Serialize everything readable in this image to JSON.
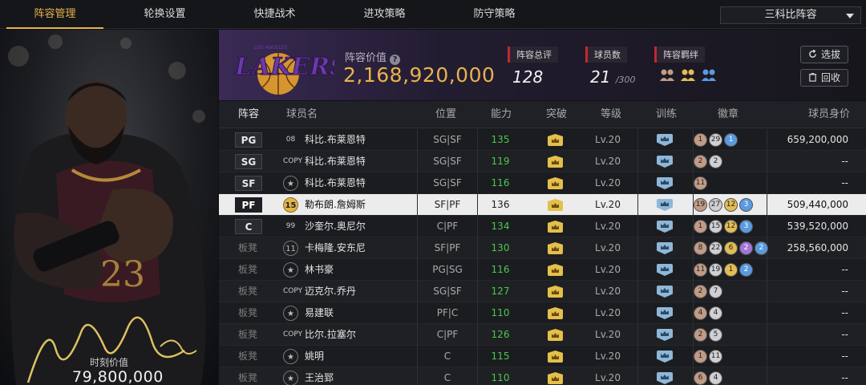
{
  "nav": {
    "tabs": [
      "阵容管理",
      "轮换设置",
      "快捷战术",
      "进攻策略",
      "防守策略"
    ],
    "active_tab": 0,
    "team_select": "三科比阵容"
  },
  "card": {
    "value_label": "时刻价值",
    "value": "79,800,000",
    "jersey_text": "23"
  },
  "header": {
    "logo_text": "LAKERS",
    "logo_subtext": "LOS ANGELES",
    "value_title": "阵容价值",
    "team_value": "2,168,920,000",
    "stats": [
      {
        "label": "阵容总评",
        "value": "128"
      },
      {
        "label": "球员数",
        "value": "21",
        "suffix": "/300"
      },
      {
        "label": "阵容羁绊"
      }
    ],
    "buttons": {
      "pick": "选拔",
      "recycle": "回收"
    }
  },
  "table": {
    "headers": [
      "阵容",
      "球员名",
      "位置",
      "能力",
      "突破",
      "等级",
      "训练",
      "徽章",
      "球员身价"
    ],
    "rows": [
      {
        "slot": "PG",
        "starter": true,
        "num": "08",
        "num_style": "text",
        "name": "科比.布莱恩特",
        "pos": "SG|SF",
        "ability": "135",
        "level": "Lv.20",
        "badges": [
          [
            "bronze",
            "1"
          ],
          [
            "silver",
            "29"
          ],
          [
            "blue",
            "1"
          ]
        ],
        "salary": "659,200,000"
      },
      {
        "slot": "SG",
        "starter": true,
        "num": "COPY",
        "num_style": "text",
        "name": "科比.布莱恩特",
        "pos": "SG|SF",
        "ability": "119",
        "level": "Lv.20",
        "badges": [
          [
            "bronze",
            "2"
          ],
          [
            "silver",
            "2"
          ]
        ],
        "salary": "--"
      },
      {
        "slot": "SF",
        "starter": true,
        "num": "★",
        "num_style": "hex",
        "name": "科比.布莱恩特",
        "pos": "SG|SF",
        "ability": "116",
        "level": "Lv.20",
        "badges": [
          [
            "bronze",
            "11"
          ]
        ],
        "salary": "--"
      },
      {
        "slot": "PF",
        "starter": true,
        "selected": true,
        "num": "15",
        "num_style": "gold",
        "name": "勒布朗.詹姆斯",
        "pos": "SF|PF",
        "ability": "136",
        "level": "Lv.20",
        "badges": [
          [
            "bronze",
            "19"
          ],
          [
            "silver",
            "27"
          ],
          [
            "gold",
            "12"
          ],
          [
            "blue",
            "3"
          ]
        ],
        "salary": "509,440,000"
      },
      {
        "slot": "C",
        "starter": true,
        "num": "99",
        "num_style": "text",
        "name": "沙奎尔.奥尼尔",
        "pos": "C|PF",
        "ability": "134",
        "level": "Lv.20",
        "badges": [
          [
            "bronze",
            "1"
          ],
          [
            "silver",
            "15"
          ],
          [
            "gold",
            "12"
          ],
          [
            "blue",
            "3"
          ]
        ],
        "salary": "539,520,000"
      },
      {
        "slot": "板凳",
        "num": "11",
        "num_style": "hex",
        "name": "卡梅隆.安东尼",
        "pos": "SF|PF",
        "ability": "130",
        "level": "Lv.20",
        "badges": [
          [
            "bronze",
            "8"
          ],
          [
            "silver",
            "22"
          ],
          [
            "gold",
            "6"
          ],
          [
            "purple",
            "2"
          ],
          [
            "blue",
            "2"
          ]
        ],
        "salary": "258,560,000"
      },
      {
        "slot": "板凳",
        "num": "★",
        "num_style": "hex",
        "name": "林书豪",
        "pos": "PG|SG",
        "ability": "116",
        "level": "Lv.20",
        "badges": [
          [
            "bronze",
            "11"
          ],
          [
            "silver",
            "19"
          ],
          [
            "gold",
            "1"
          ],
          [
            "blue",
            "2"
          ]
        ],
        "salary": "--"
      },
      {
        "slot": "板凳",
        "num": "COPY",
        "num_style": "text",
        "name": "迈克尔.乔丹",
        "pos": "SG|SF",
        "ability": "127",
        "level": "Lv.20",
        "badges": [
          [
            "bronze",
            "2"
          ],
          [
            "silver",
            "7"
          ]
        ],
        "salary": "--"
      },
      {
        "slot": "板凳",
        "num": "★",
        "num_style": "hex",
        "name": "易建联",
        "pos": "PF|C",
        "ability": "110",
        "level": "Lv.20",
        "badges": [
          [
            "bronze",
            "4"
          ],
          [
            "silver",
            "4"
          ]
        ],
        "salary": "--"
      },
      {
        "slot": "板凳",
        "num": "COPY",
        "num_style": "text",
        "name": "比尔.拉塞尔",
        "pos": "C|PF",
        "ability": "126",
        "level": "Lv.20",
        "badges": [
          [
            "bronze",
            "2"
          ],
          [
            "silver",
            "5"
          ]
        ],
        "salary": "--"
      },
      {
        "slot": "板凳",
        "num": "★",
        "num_style": "hex",
        "name": "姚明",
        "pos": "C",
        "ability": "115",
        "level": "Lv.20",
        "badges": [
          [
            "bronze",
            "1"
          ],
          [
            "silver",
            "11"
          ]
        ],
        "salary": "--"
      },
      {
        "slot": "板凳",
        "num": "★",
        "num_style": "hex",
        "name": "王治郅",
        "pos": "C",
        "ability": "110",
        "level": "Lv.20",
        "badges": [
          [
            "bronze",
            "6"
          ],
          [
            "silver",
            "4"
          ]
        ],
        "salary": "--"
      }
    ]
  },
  "colors": {
    "accent_gold": "#e8b24a",
    "ability_green": "#48c94a",
    "header_purple": "#3a2a55",
    "stat_marker_red": "#c2282e"
  }
}
